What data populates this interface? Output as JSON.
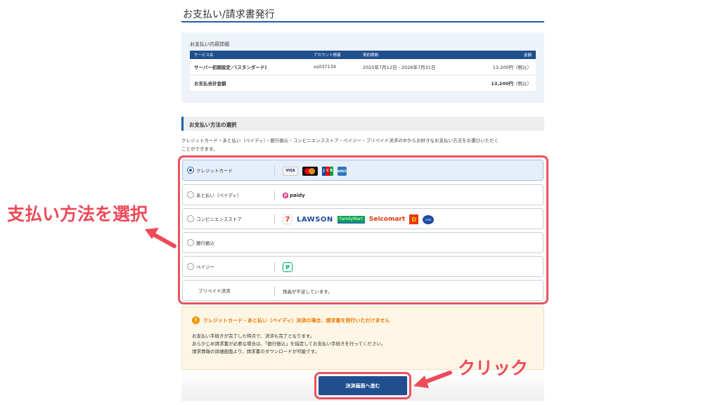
{
  "page": {
    "title": "お支払い/請求書発行"
  },
  "summary": {
    "heading": "お支払い内容詳細",
    "columns": [
      "サービス名",
      "アカウント情報",
      "契約期間",
      "金額"
    ],
    "rows": [
      {
        "service": "サーバー初期設定／(スタンダード)",
        "account": "xs037134",
        "period": "2025年7月12日 - 2026年7月31日",
        "amount": "13,200円",
        "tax": "（税込）"
      }
    ],
    "total": {
      "label": "お支払合計金額",
      "amount": "13,200円",
      "tax": "（税込）"
    }
  },
  "methods": {
    "heading": "お支払い方法の選択",
    "description_line1": "クレジットカード・あと払い（ペイディ）・銀行振込・コンビニエンスストア・ペイジー・プリペイド決済の中からお好きなお支払い方法をお選びいただく",
    "description_line2": "ことができます。",
    "options": [
      {
        "label": "クレジットカード",
        "selected": true,
        "logos": [
          "visa-logo",
          "mastercard-logo",
          "jcb-logo",
          "amex-logo"
        ]
      },
      {
        "label": "あと払い（ペイディ）",
        "selected": false,
        "logos": [
          "paidy-logo"
        ]
      },
      {
        "label": "コンビニエンスストア",
        "selected": false,
        "logos": [
          "seven-eleven-logo",
          "lawson-logo",
          "familymart-logo",
          "seicomart-logo",
          "daily-yamazaki-logo",
          "ministop-logo"
        ]
      },
      {
        "label": "銀行振込",
        "selected": false,
        "logos": []
      },
      {
        "label": "ペイジー",
        "selected": false,
        "logos": [
          "payeasy-logo"
        ]
      },
      {
        "label": "プリペイド決済",
        "selected": false,
        "note": "残高が不足しています。"
      }
    ],
    "logo_text": {
      "visa": "VISA",
      "paidy": "paidy",
      "seven": "7",
      "lawson": "LAWSON",
      "familymart": "FamilyMart",
      "seicomart": "Seicomart",
      "daily": "D",
      "ministop": "mini",
      "payeasy": "P",
      "jcb_letters": [
        "J",
        "C",
        "B"
      ],
      "amex": "AMEX"
    }
  },
  "notice": {
    "icon": "!",
    "title": "クレジットカード・あと払い（ペイディ）決済の場合、請求書を発行いただけません",
    "line1": "お支払い手続きが完了した時点で、決済も完了となります。",
    "line2": "あらかじめ請求書が必要な場合は、「銀行振込」を指定してお支払い手続きを行ってください。",
    "line3": "請求情報の詳細画面より、請求書のダウンロードが可能です。"
  },
  "button": {
    "label": "決済画面へ進む"
  },
  "annotations": {
    "left_text": "支払い方法を選択",
    "right_text": "クリック",
    "color": "#ee4a59"
  },
  "colors": {
    "primary": "#1f4f8f",
    "accent_red": "#e9535e",
    "notice_orange": "#ea7b00",
    "notice_bg": "#fdf6e6"
  }
}
